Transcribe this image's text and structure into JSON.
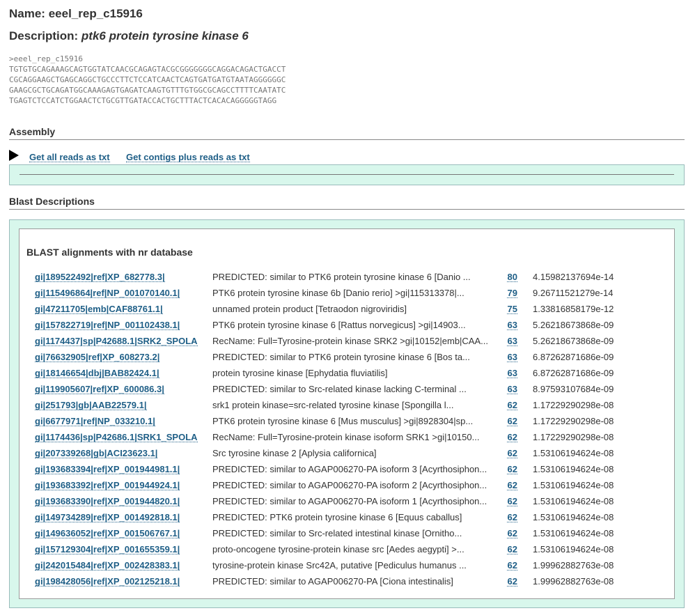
{
  "record": {
    "name_label": "Name:",
    "name_value": "eeel_rep_c15916",
    "description_label": "Description:",
    "description_value": "ptk6 protein tyrosine kinase 6",
    "sequence": ">eeel_rep_c15916\nTGTGTGCAGAAAGCAGTGGTATCAACGCAGAGTACGCGGGGGGGCAGGACAGACTGACCT\nCGCAGGAAGCTGAGCAGGCTGCCCTTCTCCATCAACTCAGTGATGATGTAATAGGGGGGC\nGAAGCGCTGCAGATGGCAAAGAGTGAGATCAAGTGTTTGTGGCGCAGCCTTTTCAATATC\nTGAGTCTCCATCTGGAACTCTGCGTTGATACCACTGCTTTACTCACACAGGGGGTAGG"
  },
  "assembly": {
    "title": "Assembly",
    "links": [
      "Get all reads as txt",
      "Get contigs plus reads as txt"
    ]
  },
  "blast": {
    "section_title": "Blast Descriptions",
    "heading": "BLAST alignments with nr database",
    "rows": [
      {
        "acc": "gi|189522492|ref|XP_682778.3|",
        "desc": "PREDICTED: similar to PTK6 protein tyrosine kinase 6 [Danio ...",
        "score": "80",
        "evalue": "4.15982137694e-14"
      },
      {
        "acc": "gi|115496864|ref|NP_001070140.1|",
        "desc": "PTK6 protein tyrosine kinase 6b [Danio rerio] >gi|115313378|...",
        "score": "79",
        "evalue": "9.26711521279e-14"
      },
      {
        "acc": "gi|47211705|emb|CAF88761.1|",
        "desc": "unnamed protein product [Tetraodon nigroviridis]",
        "score": "75",
        "evalue": "1.33816858179e-12"
      },
      {
        "acc": "gi|157822719|ref|NP_001102438.1|",
        "desc": "PTK6 protein tyrosine kinase 6 [Rattus norvegicus] >gi|14903...",
        "score": "63",
        "evalue": "5.26218673868e-09"
      },
      {
        "acc": "gi|1174437|sp|P42688.1|SRK2_SPOLA",
        "desc": "RecName: Full=Tyrosine-protein kinase SRK2 >gi|10152|emb|CAA...",
        "score": "63",
        "evalue": "5.26218673868e-09"
      },
      {
        "acc": "gi|76632905|ref|XP_608273.2|",
        "desc": "PREDICTED: similar to PTK6 protein tyrosine kinase 6 [Bos ta...",
        "score": "63",
        "evalue": "6.87262871686e-09"
      },
      {
        "acc": "gi|18146654|dbj|BAB82424.1|",
        "desc": "protein tyrosine kinase [Ephydatia fluviatilis]",
        "score": "63",
        "evalue": "6.87262871686e-09"
      },
      {
        "acc": "gi|119905607|ref|XP_600086.3|",
        "desc": "PREDICTED: similar to Src-related kinase lacking C-terminal ...",
        "score": "63",
        "evalue": "8.97593107684e-09"
      },
      {
        "acc": "gi|251793|gb|AAB22579.1|",
        "desc": "srk1 protein kinase=src-related tyrosine kinase [Spongilla l...",
        "score": "62",
        "evalue": "1.17229290298e-08"
      },
      {
        "acc": "gi|6677971|ref|NP_033210.1|",
        "desc": "PTK6 protein tyrosine kinase 6 [Mus musculus] >gi|8928304|sp...",
        "score": "62",
        "evalue": "1.17229290298e-08"
      },
      {
        "acc": "gi|1174436|sp|P42686.1|SRK1_SPOLA",
        "desc": "RecName: Full=Tyrosine-protein kinase isoform SRK1 >gi|10150...",
        "score": "62",
        "evalue": "1.17229290298e-08"
      },
      {
        "acc": "gi|207339268|gb|ACI23623.1|",
        "desc": "Src tyrosine kinase 2 [Aplysia californica]",
        "score": "62",
        "evalue": "1.53106194624e-08"
      },
      {
        "acc": "gi|193683394|ref|XP_001944981.1|",
        "desc": "PREDICTED: similar to AGAP006270-PA isoform 3 [Acyrthosiphon...",
        "score": "62",
        "evalue": "1.53106194624e-08"
      },
      {
        "acc": "gi|193683392|ref|XP_001944924.1|",
        "desc": "PREDICTED: similar to AGAP006270-PA isoform 2 [Acyrthosiphon...",
        "score": "62",
        "evalue": "1.53106194624e-08"
      },
      {
        "acc": "gi|193683390|ref|XP_001944820.1|",
        "desc": "PREDICTED: similar to AGAP006270-PA isoform 1 [Acyrthosiphon...",
        "score": "62",
        "evalue": "1.53106194624e-08"
      },
      {
        "acc": "gi|149734289|ref|XP_001492818.1|",
        "desc": "PREDICTED: PTK6 protein tyrosine kinase 6 [Equus caballus]",
        "score": "62",
        "evalue": "1.53106194624e-08"
      },
      {
        "acc": "gi|149636052|ref|XP_001506767.1|",
        "desc": "PREDICTED: similar to Src-related intestinal kinase [Ornitho...",
        "score": "62",
        "evalue": "1.53106194624e-08"
      },
      {
        "acc": "gi|157129304|ref|XP_001655359.1|",
        "desc": "proto-oncogene tyrosine-protein kinase src [Aedes aegypti] >...",
        "score": "62",
        "evalue": "1.53106194624e-08"
      },
      {
        "acc": "gi|242015484|ref|XP_002428383.1|",
        "desc": "tyrosine-protein kinase Src42A, putative [Pediculus humanus ...",
        "score": "62",
        "evalue": "1.99962882763e-08"
      },
      {
        "acc": "gi|198428056|ref|XP_002125218.1|",
        "desc": "PREDICTED: similar to AGAP006270-PA [Ciona intestinalis]",
        "score": "62",
        "evalue": "1.99962882763e-08"
      }
    ]
  }
}
